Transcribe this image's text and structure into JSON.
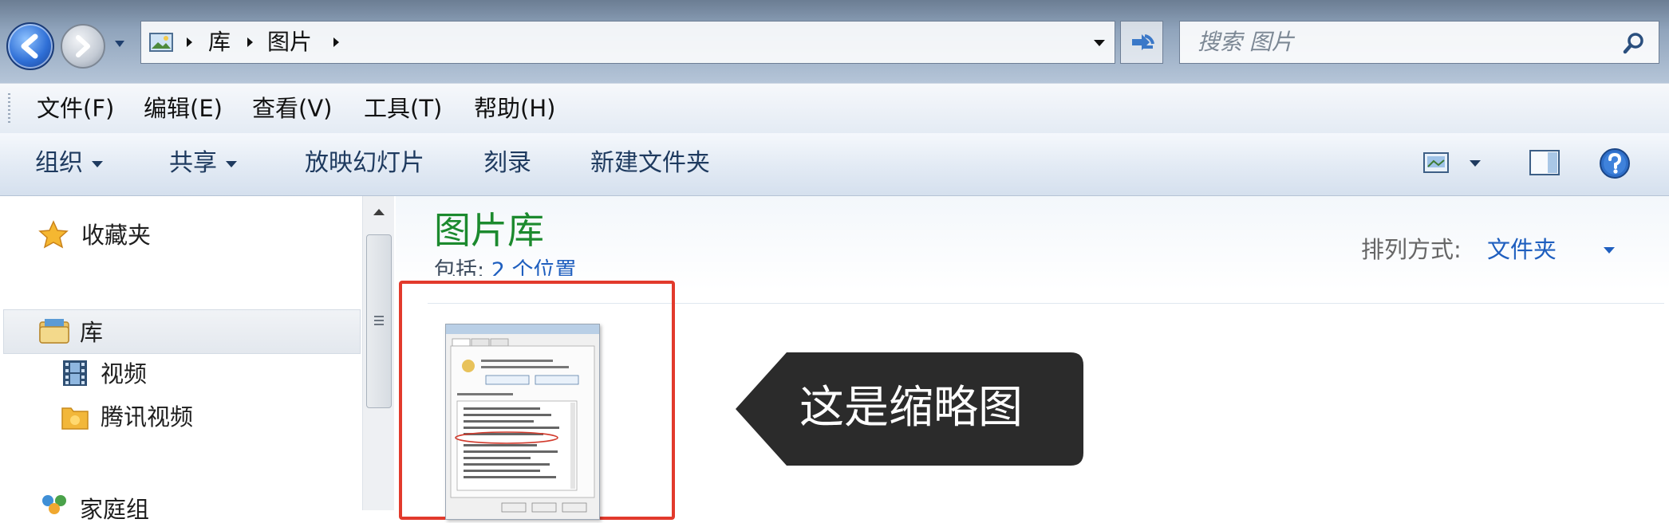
{
  "address_bar": {
    "crumbs": [
      "库",
      "图片"
    ],
    "search_placeholder": "搜索 图片"
  },
  "menu": {
    "items": [
      "文件(F)",
      "编辑(E)",
      "查看(V)",
      "工具(T)",
      "帮助(H)"
    ]
  },
  "toolbar": {
    "organize": "组织",
    "share": "共享",
    "slideshow": "放映幻灯片",
    "burn": "刻录",
    "new_folder": "新建文件夹"
  },
  "nav_pane": {
    "favorites": "收藏夹",
    "libraries": "库",
    "videos": "视频",
    "tencent_video": "腾讯视频",
    "homegroup": "家庭组"
  },
  "content": {
    "title": "图片库",
    "includes_label": "包括:",
    "includes_link": "2 个位置",
    "arrange_label": "排列方式:",
    "arrange_value": "文件夹"
  },
  "annotation": {
    "callout_text": "这是缩略图"
  },
  "colors": {
    "title_green": "#1c8a2e",
    "link_blue": "#1f5fbf",
    "highlight_red": "#e23a2c",
    "callout_bg": "#2b2b2b"
  }
}
